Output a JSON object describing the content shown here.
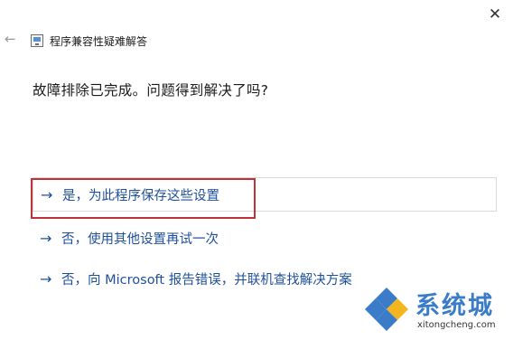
{
  "window": {
    "title": "程序兼容性疑难解答",
    "close_glyph": "✕",
    "back_glyph": "←"
  },
  "question": "故障排除已完成。问题得到解决了吗?",
  "options": [
    {
      "label": "是，为此程序保存这些设置",
      "highlighted": true
    },
    {
      "label": "否，使用其他设置再试一次",
      "highlighted": false
    },
    {
      "label": "否，向 Microsoft 报告错误，并联机查找解决方案",
      "highlighted": false
    }
  ],
  "arrow_glyph": "→",
  "watermark": {
    "text_cn": "系统城",
    "text_en": "xitongcheng.com"
  },
  "colors": {
    "link": "#1e4f9c",
    "highlight_border": "#c0313a",
    "watermark_blue": "#3a7cc8",
    "watermark_yellow": "#f3b61f"
  },
  "icons": {
    "close": "close-icon",
    "back": "back-arrow-icon",
    "app": "program-compatibility-icon",
    "option_arrow": "arrow-right-icon"
  }
}
